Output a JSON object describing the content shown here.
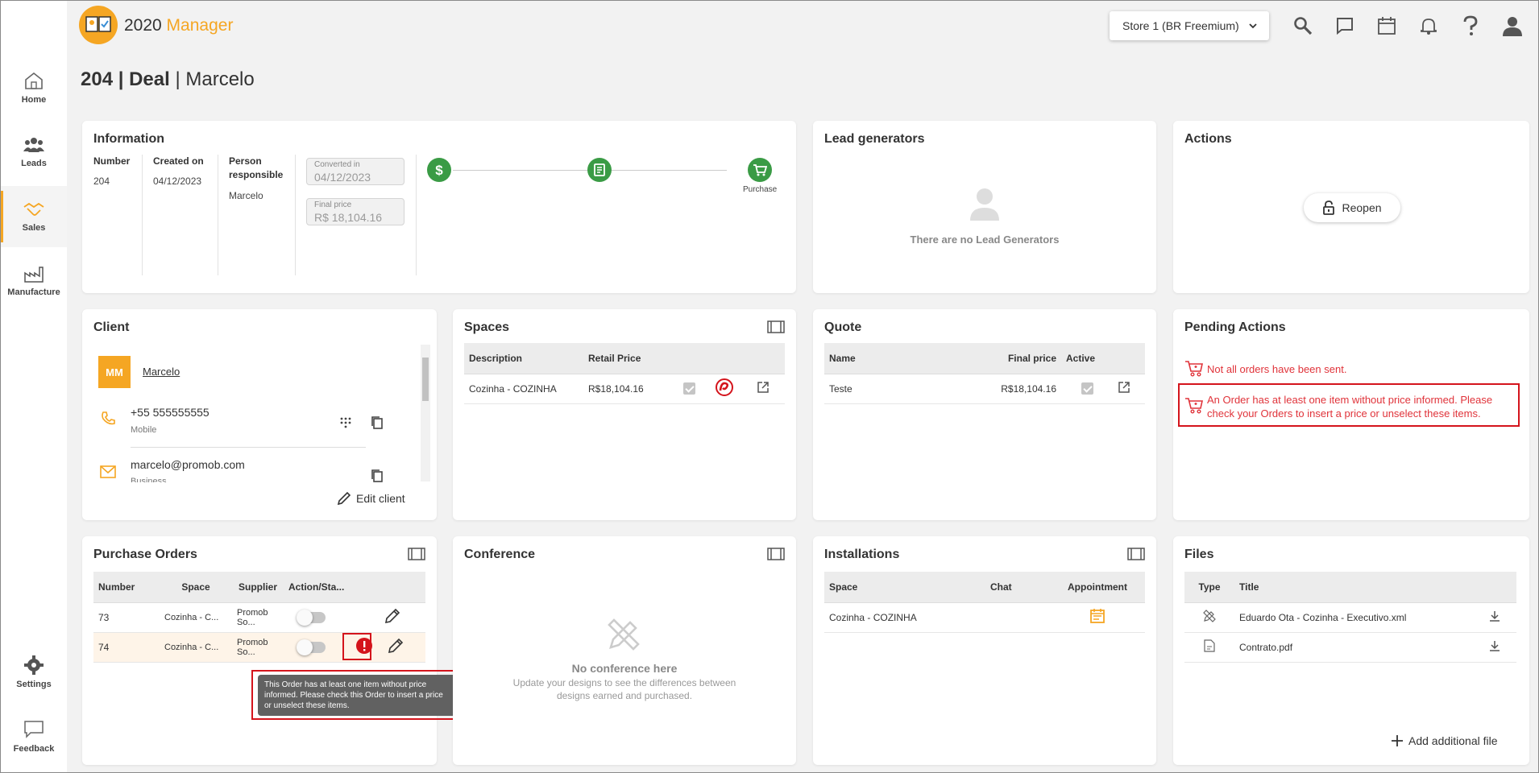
{
  "app": {
    "brand_prefix": "2020",
    "brand_suffix": " Manager"
  },
  "store": {
    "selected": "Store 1 (BR Freemium)"
  },
  "nav": [
    {
      "label": "Home",
      "icon": "home-icon"
    },
    {
      "label": "Leads",
      "icon": "users-icon"
    },
    {
      "label": "Sales",
      "icon": "handshake-icon"
    },
    {
      "label": "Manufacture",
      "icon": "factory-icon"
    },
    {
      "label": "Settings",
      "icon": "gear-icon"
    },
    {
      "label": "Feedback",
      "icon": "chat-icon"
    }
  ],
  "page": {
    "title_strong": "204 | Deal",
    "title_rest": " | Marcelo"
  },
  "information": {
    "title": "Information",
    "number_label": "Number",
    "number": "204",
    "created_label": "Created on",
    "created": "04/12/2023",
    "person_label": "Person responsible",
    "person": "Marcelo",
    "converted_label": "Converted in",
    "converted": "04/12/2023",
    "final_label": "Final price",
    "final": "R$ 18,104.16",
    "step_purchase": "Purchase"
  },
  "lead_generators": {
    "title": "Lead generators",
    "empty": "There are no Lead Generators"
  },
  "actions": {
    "title": "Actions",
    "reopen": "Reopen"
  },
  "client": {
    "title": "Client",
    "initials": "MM",
    "name": "Marcelo",
    "phone": "+55 555555555",
    "phone_type": "Mobile",
    "email": "marcelo@promob.com",
    "email_type": "Business",
    "edit": "Edit client"
  },
  "spaces": {
    "title": "Spaces",
    "headers": [
      "Description",
      "Retail Price"
    ],
    "rows": [
      {
        "description": "Cozinha - COZINHA",
        "price": "R$18,104.16"
      }
    ]
  },
  "quote": {
    "title": "Quote",
    "headers": [
      "Name",
      "Final price",
      "Active"
    ],
    "rows": [
      {
        "name": "Teste",
        "price": "R$18,104.16"
      }
    ]
  },
  "pending": {
    "title": "Pending Actions",
    "items": [
      "Not all orders have been sent.",
      "An Order has at least one item without price informed. Please check your Orders to insert a price or unselect these items."
    ]
  },
  "purchase_orders": {
    "title": "Purchase Orders",
    "headers": [
      "Number",
      "Space",
      "Supplier",
      "Action/Sta..."
    ],
    "rows": [
      {
        "number": "73",
        "space": "Cozinha - C...",
        "supplier": "Promob So..."
      },
      {
        "number": "74",
        "space": "Cozinha - C...",
        "supplier": "Promob So..."
      }
    ],
    "tooltip": "This Order has at least one item without price informed. Please check this Order to insert a price or unselect these items."
  },
  "conference": {
    "title": "Conference",
    "empty": "No conference here",
    "sub": "Update your designs to see the differences between designs earned and purchased."
  },
  "installations": {
    "title": "Installations",
    "headers": [
      "Space",
      "Chat",
      "Appointment"
    ],
    "rows": [
      {
        "space": "Cozinha - COZINHA"
      }
    ]
  },
  "files": {
    "title": "Files",
    "headers": [
      "Type",
      "Title"
    ],
    "rows": [
      {
        "title": "Eduardo Ota - Cozinha - Executivo.xml"
      },
      {
        "title": "Contrato.pdf"
      }
    ],
    "add": "Add additional file"
  },
  "colors": {
    "accent": "#f5a623",
    "success": "#3a9b45",
    "danger": "#e0333a"
  }
}
